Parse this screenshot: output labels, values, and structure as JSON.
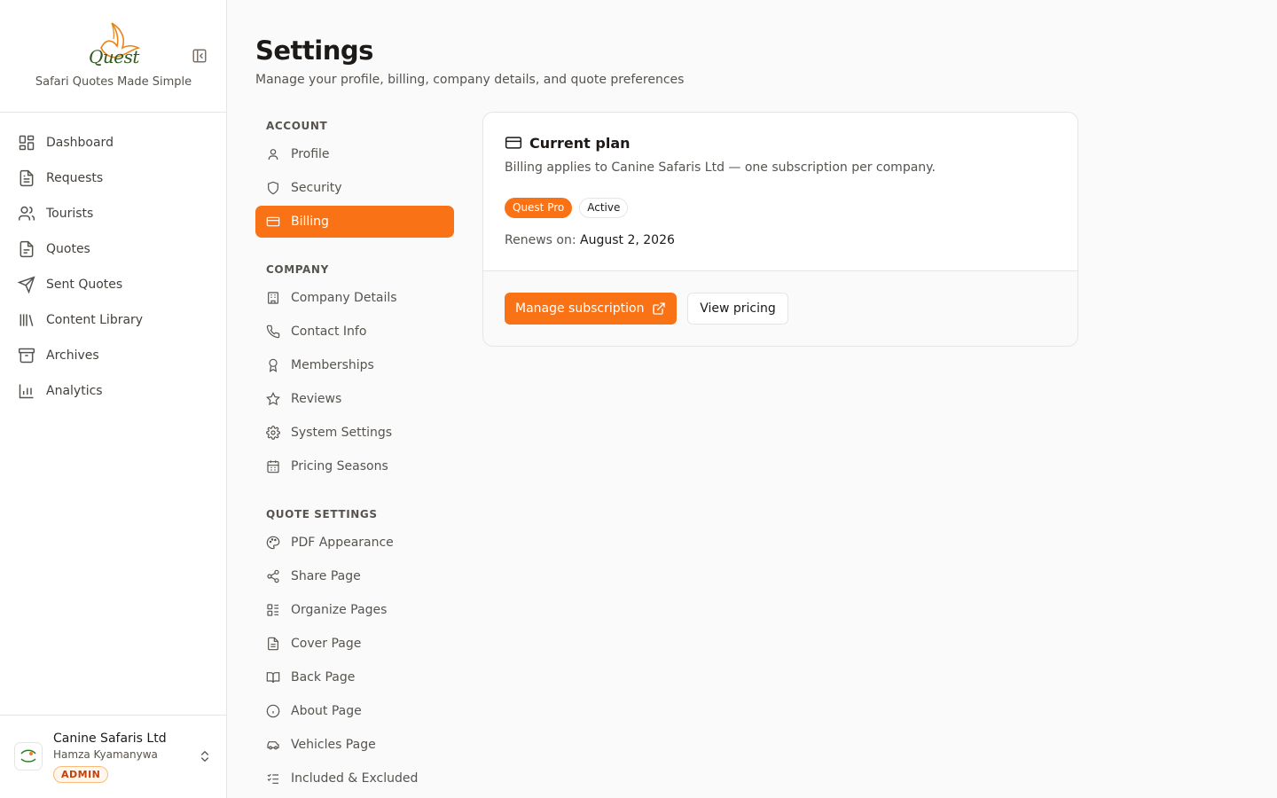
{
  "brand": {
    "logo_text": "Quest",
    "tagline": "Safari Quotes Made Simple"
  },
  "sidebar": {
    "items": [
      {
        "label": "Dashboard",
        "icon": "dashboard-icon"
      },
      {
        "label": "Requests",
        "icon": "file-text-icon"
      },
      {
        "label": "Tourists",
        "icon": "users-icon"
      },
      {
        "label": "Quotes",
        "icon": "file-icon"
      },
      {
        "label": "Sent Quotes",
        "icon": "send-icon"
      },
      {
        "label": "Content Library",
        "icon": "library-icon"
      },
      {
        "label": "Archives",
        "icon": "archive-icon"
      },
      {
        "label": "Analytics",
        "icon": "bar-chart-icon"
      }
    ]
  },
  "account": {
    "company": "Canine Safaris Ltd",
    "user": "Hamza Kyamanywa",
    "role": "ADMIN"
  },
  "page": {
    "title": "Settings",
    "subtitle": "Manage your profile, billing, company details, and quote preferences"
  },
  "settings_nav": {
    "account_label": "ACCOUNT",
    "account": [
      "Profile",
      "Security",
      "Billing"
    ],
    "company_label": "COMPANY",
    "company": [
      "Company Details",
      "Contact Info",
      "Memberships",
      "Reviews",
      "System Settings",
      "Pricing Seasons"
    ],
    "quote_label": "QUOTE SETTINGS",
    "quote": [
      "PDF Appearance",
      "Share Page",
      "Organize Pages",
      "Cover Page",
      "Back Page",
      "About Page",
      "Vehicles Page",
      "Included & Excluded"
    ],
    "active": "Billing"
  },
  "billing": {
    "title": "Current plan",
    "description": "Billing applies to Canine Safaris Ltd — one subscription per company.",
    "plan_badge": "Quest Pro",
    "status_badge": "Active",
    "renews_label": "Renews on:",
    "renews_date": "August 2, 2026",
    "manage_label": "Manage subscription",
    "pricing_label": "View pricing"
  },
  "colors": {
    "accent": "#f97316",
    "logo_green": "#2f5a1e"
  }
}
